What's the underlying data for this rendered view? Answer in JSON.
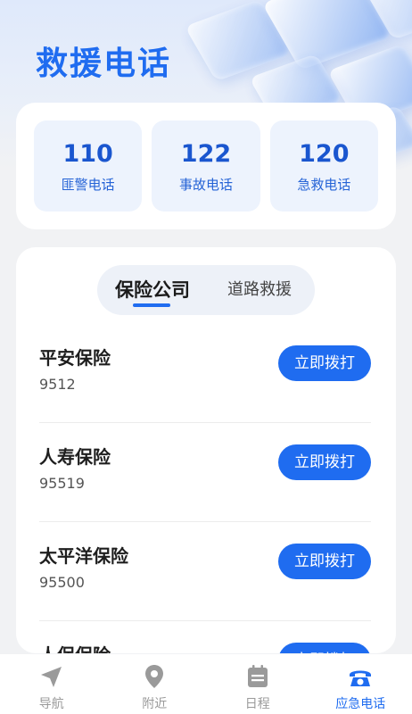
{
  "page": {
    "title": "救援电话"
  },
  "hotlines": [
    {
      "number": "110",
      "label": "匪警电话"
    },
    {
      "number": "122",
      "label": "事故电话"
    },
    {
      "number": "120",
      "label": "急救电话"
    }
  ],
  "tabs": [
    {
      "label": "保险公司",
      "active": true
    },
    {
      "label": "道路救援",
      "active": false
    }
  ],
  "companies": [
    {
      "name": "平安保险",
      "phone": "9512",
      "action": "立即拨打"
    },
    {
      "name": "人寿保险",
      "phone": "95519",
      "action": "立即拨打"
    },
    {
      "name": "太平洋保险",
      "phone": "95500",
      "action": "立即拨打"
    },
    {
      "name": "人保保险",
      "phone": "",
      "action": "立即拨打"
    }
  ],
  "tabbar": [
    {
      "label": "导航",
      "icon": "navigation-arrow-icon",
      "active": false
    },
    {
      "label": "附近",
      "icon": "location-pin-icon",
      "active": false
    },
    {
      "label": "日程",
      "icon": "calendar-icon",
      "active": false
    },
    {
      "label": "应急电话",
      "icon": "phone-icon",
      "active": true
    }
  ],
  "colors": {
    "accent": "#1f6cf0",
    "background": "#f1f2f4",
    "tab_inactive": "#9a9a9a"
  }
}
